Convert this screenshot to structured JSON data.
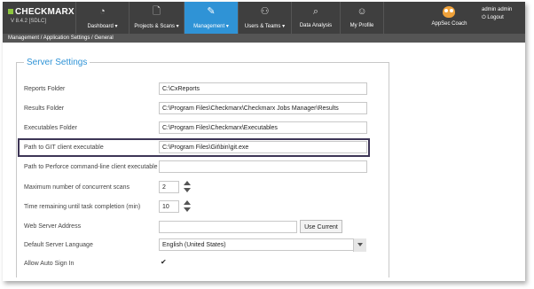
{
  "app": {
    "logo": "CHECKMARX",
    "version": "V 8.4.2  [SDLC]"
  },
  "nav": {
    "items": [
      {
        "label": "Dashboard",
        "icon": "dashboard-gauge-icon"
      },
      {
        "label": "Projects & Scans",
        "icon": "projects-scans-icon"
      },
      {
        "label": "Management",
        "icon": "wrench-icon"
      },
      {
        "label": "Users & Teams",
        "icon": "users-icon"
      },
      {
        "label": "Data Analysis",
        "icon": "magnifier-icon"
      },
      {
        "label": "My Profile",
        "icon": "profile-icon"
      }
    ],
    "coach": "AppSec Coach",
    "user": "admin admin",
    "logout": "Logout"
  },
  "breadcrumb": "Management / Application Settings / General",
  "section": {
    "title": "Server Settings"
  },
  "fields": {
    "reports_folder": {
      "label": "Reports Folder",
      "value": "C:\\CxReports"
    },
    "results_folder": {
      "label": "Results Folder",
      "value": "C:\\Program Files\\Checkmarx\\Checkmarx Jobs Manager\\Results"
    },
    "executables_folder": {
      "label": "Executables Folder",
      "value": "C:\\Program Files\\Checkmarx\\Executables"
    },
    "git_path": {
      "label": "Path to GIT client executable",
      "value": "C:\\Program Files\\Git\\bin\\git.exe"
    },
    "perforce_path": {
      "label": "Path to Perforce command-line client executable",
      "value": ""
    },
    "max_scans": {
      "label": "Maximum number of concurrent scans",
      "value": "2"
    },
    "time_remaining": {
      "label": "Time remaining until task completion (min)",
      "value": "10"
    },
    "web_server": {
      "label": "Web Server Address",
      "value": "",
      "button": "Use Current"
    },
    "language": {
      "label": "Default Server Language",
      "value": "English (United States)"
    },
    "auto_sign_in": {
      "label": "Allow Auto Sign In",
      "checked": "✔"
    }
  },
  "colors": {
    "topbar": "#3f3f3f",
    "active_nav": "#2f93d6",
    "section_title": "#2f93d6",
    "highlight_border": "#3d3556"
  }
}
